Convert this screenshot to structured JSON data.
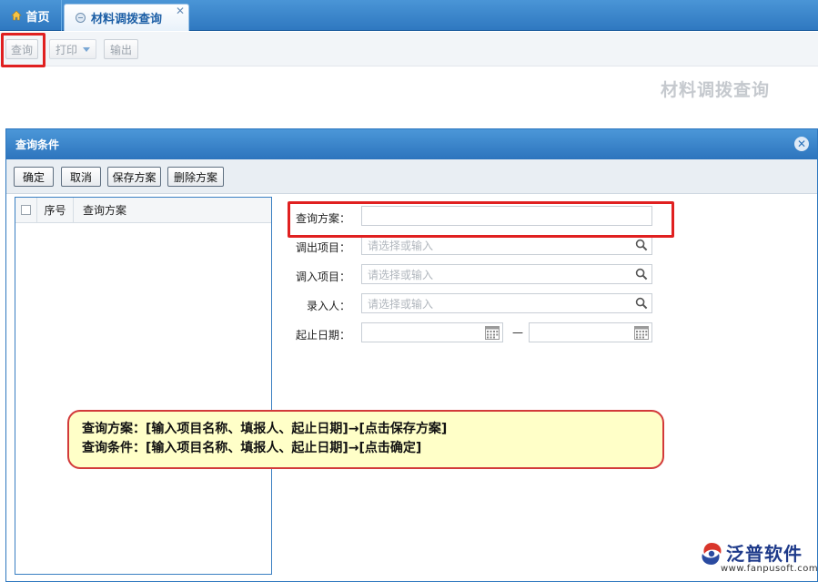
{
  "tabs": {
    "home_label": "首页",
    "active_label": "材料调拨查询",
    "close_glyph": "✕"
  },
  "toolbar": {
    "query_label": "查询",
    "print_label": "打印",
    "export_label": "输出"
  },
  "page_title": "材料调拨查询",
  "dialog": {
    "title": "查询条件",
    "close_glyph": "✕",
    "actions": {
      "confirm_label": "确定",
      "cancel_label": "取消",
      "save_plan_label": "保存方案",
      "delete_plan_label": "删除方案"
    },
    "plan_list": {
      "columns": [
        "序号",
        "查询方案"
      ],
      "rows": []
    },
    "form": {
      "plan_label": "查询方案：",
      "plan_value": "",
      "out_project_label": "调出项目：",
      "out_project_placeholder": "请选择或输入",
      "in_project_label": "调入项目：",
      "in_project_placeholder": "请选择或输入",
      "entered_by_label": "录入人：",
      "entered_by_placeholder": "请选择或输入",
      "date_range_label": "起止日期：",
      "date_range_separator": "—",
      "date_from": "",
      "date_to": ""
    }
  },
  "callout": {
    "line1": "查询方案：[输入项目名称、填报人、起止日期]→[点击保存方案]",
    "line2": "查询条件：[输入项目名称、填报人、起止日期]→[点击确定]"
  },
  "logo": {
    "name": "泛普软件",
    "url": "www.fanpusoft.com"
  },
  "colors": {
    "accent_blue": "#2f78c0",
    "highlight_red": "#e02020",
    "callout_bg": "#ffffc8"
  },
  "icons": {
    "home": "home-icon",
    "tab_doc": "document-icon",
    "search": "search-icon",
    "calendar": "calendar-icon",
    "close": "close-icon",
    "dropdown": "chevron-down-icon"
  }
}
